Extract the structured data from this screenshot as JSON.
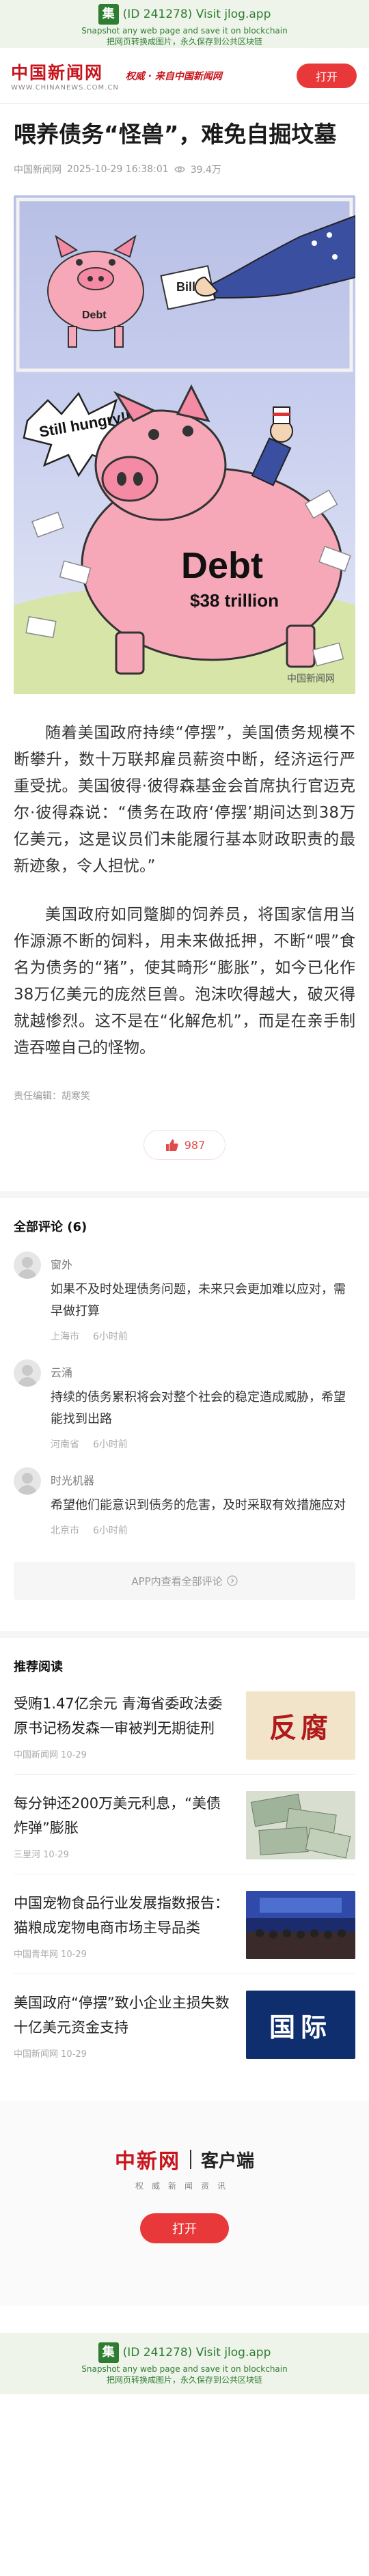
{
  "jlog": {
    "logo_char": "集",
    "visit_text": "(ID 241278) Visit jlog.app",
    "line2": "Snapshot any web page and save it on blockchain",
    "line3": "把网页转换成图片，永久保存到公共区块链"
  },
  "header": {
    "brand_name": "中国新闻网",
    "brand_sub": "WWW.CHINANEWS.COM.CN",
    "slogan": "权威 · 来自中国新闻网",
    "open_label": "打开"
  },
  "article": {
    "title": "喂养债务“怪兽”，难免自掘坟墓",
    "source": "中国新闻网",
    "datetime": "2025-10-29 16:38:01",
    "views": "39.4万",
    "image_text": {
      "bill": "Bill",
      "debt_small": "Debt",
      "still_hungry": "Still hungry!!!",
      "debt_big": "Debt",
      "amount": "$38 trillion",
      "watermark": "中国新闻网"
    },
    "paragraphs": [
      "随着美国政府持续“停摆”，美国债务规模不断攀升，数十万联邦雇员薪资中断，经济运行严重受扰。美国彼得·彼得森基金会首席执行官迈克尔·彼得森说：“债务在政府‘停摆’期间达到38万亿美元，这是议员们未能履行基本财政职责的最新迹象，令人担忧。”",
      "美国政府如同蹩脚的饲养员，将国家信用当作源源不断的饲料，用未来做抵押，不断“喂”食名为债务的“猪”，使其畸形“膨胀”，如今已化作38万亿美元的庞然巨兽。泡沫吹得越大，破灭得就越惨烈。这不是在“化解危机”，而是在亲手制造吞噬自己的怪物。"
    ],
    "editor": "责任编辑：胡寒笑",
    "likes": "987"
  },
  "comments": {
    "heading": "全部评论 (6)",
    "items": [
      {
        "user": "窗外",
        "text": "如果不及时处理债务问题，未来只会更加难以应对，需早做打算",
        "location": "上海市",
        "time": "6小时前"
      },
      {
        "user": "云涌",
        "text": "持续的债务累积将会对整个社会的稳定造成威胁，希望能找到出路",
        "location": "河南省",
        "time": "6小时前"
      },
      {
        "user": "时光机器",
        "text": "希望他们能意识到债务的危害，及时采取有效措施应对",
        "location": "北京市",
        "time": "6小时前"
      }
    ],
    "see_all": "APP内查看全部评论"
  },
  "recommended": {
    "heading": "推荐阅读",
    "items": [
      {
        "title": "受贿1.47亿余元 青海省委政法委原书记杨发森一审被判无期徒刑",
        "source": "中国新闻网",
        "date": "10-29",
        "thumb_text": "反腐"
      },
      {
        "title": "每分钟还200万美元利息，“美债炸弹”膨胀",
        "source": "三里河",
        "date": "10-29",
        "thumb_text": ""
      },
      {
        "title": "中国宠物食品行业发展指数报告：猫粮成宠物电商市场主导品类",
        "source": "中国青年网",
        "date": "10-29",
        "thumb_text": ""
      },
      {
        "title": "美国政府“停摆”致小企业主损失数十亿美元资金支持",
        "source": "中国新闻网",
        "date": "10-29",
        "thumb_text": "国际"
      }
    ]
  },
  "promo": {
    "brand": "中新网",
    "client": "客户端",
    "slogan": "权威新闻资讯",
    "open_label": "打开"
  },
  "colors": {
    "brand_red": "#c8141c",
    "button_red": "#e8383a",
    "jlog_green": "#2e7d32"
  }
}
